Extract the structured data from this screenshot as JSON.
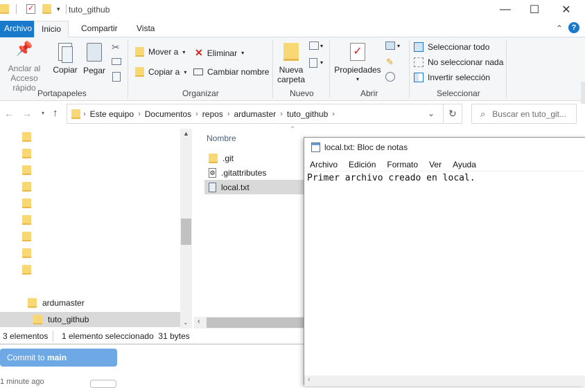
{
  "explorer": {
    "title": "tuto_github",
    "ribbon_tabs": [
      "Archivo",
      "Inicio",
      "Compartir",
      "Vista"
    ],
    "ribbon": {
      "pin_label": "Anclar al",
      "pin_label2": "Acceso rápido",
      "copy": "Copiar",
      "paste": "Pegar",
      "move_to": "Mover a",
      "copy_to": "Copiar a",
      "delete": "Eliminar",
      "rename": "Cambiar nombre",
      "new_folder": "Nueva",
      "new_folder2": "carpeta",
      "properties": "Propiedades",
      "select_all": "Seleccionar todo",
      "select_none": "No seleccionar nada",
      "invert": "Invertir selección",
      "groups": [
        "Portapapeles",
        "Organizar",
        "Nuevo",
        "Abrir",
        "Seleccionar"
      ]
    },
    "breadcrumb": [
      "Este equipo",
      "Documentos",
      "repos",
      "ardumaster",
      "tuto_github"
    ],
    "search_placeholder": "Buscar en tuto_git...",
    "nav_tree": [
      {
        "label": ""
      },
      {
        "label": ""
      },
      {
        "label": ""
      },
      {
        "label": ""
      },
      {
        "label": ""
      },
      {
        "label": ""
      },
      {
        "label": ""
      },
      {
        "label": ""
      },
      {
        "label": ""
      },
      {
        "label": "ardumaster"
      },
      {
        "label": "tuto_github"
      }
    ],
    "column_header": "Nombre",
    "files": [
      {
        "name": ".git",
        "type": "folder"
      },
      {
        "name": ".gitattributes",
        "type": "file"
      },
      {
        "name": "local.txt",
        "type": "text",
        "selected": true
      }
    ],
    "status": {
      "count": "3 elementos",
      "selected": "1 elemento seleccionado  31 bytes"
    }
  },
  "github_desktop": {
    "commit_prefix": "Commit to ",
    "commit_branch": "main",
    "time": "1 minute ago"
  },
  "notepad": {
    "title": "local.txt: Bloc de notas",
    "menu": [
      "Archivo",
      "Edición",
      "Formato",
      "Ver",
      "Ayuda"
    ],
    "content": "Primer archivo creado en local."
  },
  "colors": {
    "accent": "#1979ca",
    "folder": "#f8d775",
    "delete_x": "#d32020",
    "commit_button": "#6ea8e5"
  }
}
